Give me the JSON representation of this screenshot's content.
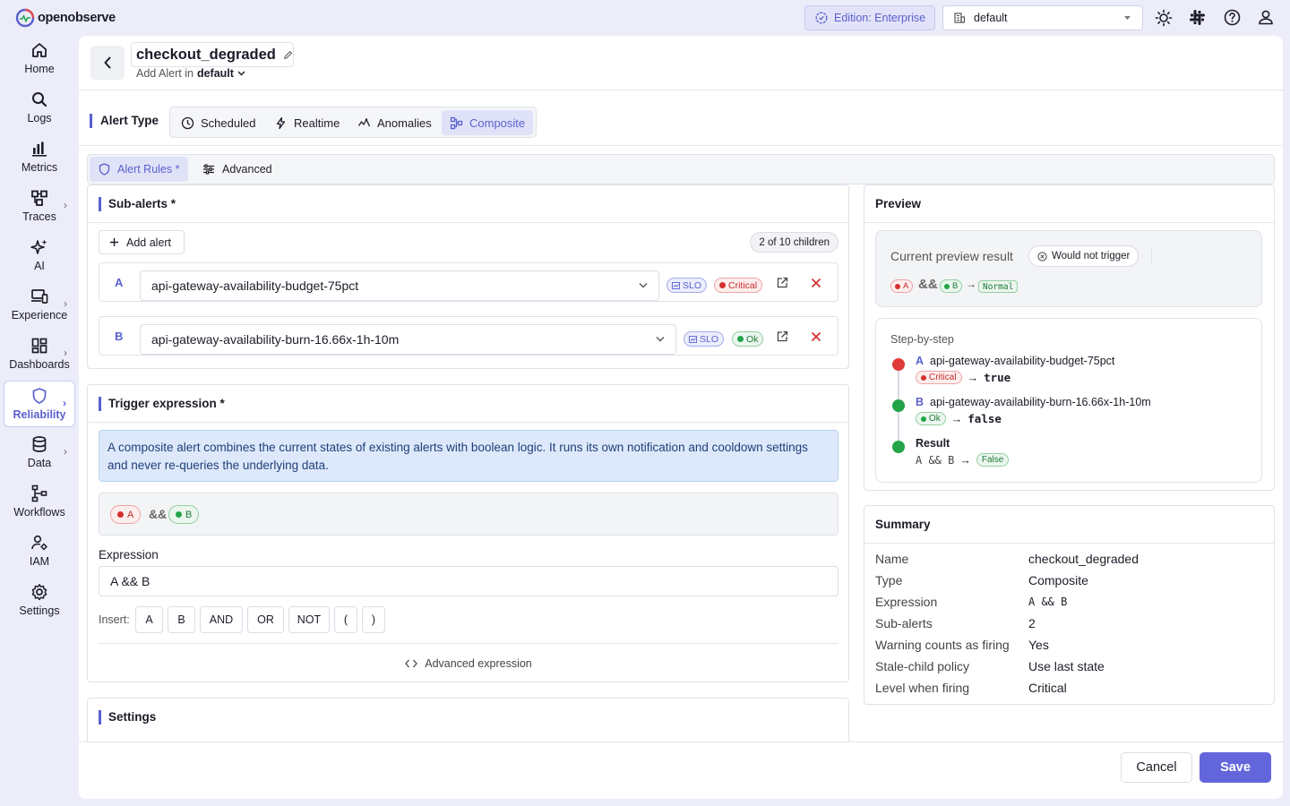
{
  "app": {
    "brand": "openobserve",
    "accent": "#5a60cf"
  },
  "topbar": {
    "edition": "Edition: Enterprise",
    "org": "default",
    "icons": [
      "theme-sun-icon",
      "slack-icon",
      "help-icon",
      "user-icon"
    ]
  },
  "sidebar": {
    "items": [
      {
        "label": "Home",
        "icon": "home-icon",
        "expand": false
      },
      {
        "label": "Logs",
        "icon": "search-icon",
        "expand": false
      },
      {
        "label": "Metrics",
        "icon": "bar-chart-icon",
        "expand": false
      },
      {
        "label": "Traces",
        "icon": "traces-icon",
        "expand": true
      },
      {
        "label": "AI",
        "icon": "sparkle-icon",
        "expand": false
      },
      {
        "label": "Experience",
        "icon": "devices-icon",
        "expand": true
      },
      {
        "label": "Dashboards",
        "icon": "dashboard-icon",
        "expand": true
      },
      {
        "label": "Reliability",
        "icon": "shield-icon",
        "expand": true,
        "active": true
      },
      {
        "label": "Data",
        "icon": "database-icon",
        "expand": true
      },
      {
        "label": "Workflows",
        "icon": "workflow-icon",
        "expand": false
      },
      {
        "label": "IAM",
        "icon": "user-gear-icon",
        "expand": false
      },
      {
        "label": "Settings",
        "icon": "gear-icon",
        "expand": false
      }
    ]
  },
  "header": {
    "title": "checkout_degraded",
    "subtitle_prefix": "Add Alert in",
    "folder": "default"
  },
  "alert_type": {
    "label": "Alert Type",
    "tabs": [
      "Scheduled",
      "Realtime",
      "Anomalies",
      "Composite"
    ],
    "selected": "Composite"
  },
  "rule_tabs": {
    "items": [
      "Alert Rules *",
      "Advanced"
    ],
    "selected": "Alert Rules *"
  },
  "subalerts": {
    "title": "Sub-alerts *",
    "add_label": "Add alert",
    "count": "2 of 10 children",
    "rows": [
      {
        "letter": "A",
        "name": "api-gateway-availability-budget-75pct",
        "kind": "SLO",
        "state": "Critical"
      },
      {
        "letter": "B",
        "name": "api-gateway-availability-burn-16.66x-1h-10m",
        "kind": "SLO",
        "state": "Ok"
      }
    ]
  },
  "trigger": {
    "title": "Trigger expression *",
    "info": "A composite alert combines the current states of existing alerts with boolean logic. It runs its own notification and cooldown settings and never re-queries the underlying data.",
    "visual": {
      "a": "A",
      "op": "&&",
      "b": "B"
    },
    "expression_label": "Expression",
    "expression_value": "A && B",
    "insert_label": "Insert:",
    "insert_tokens": [
      "A",
      "B",
      "AND",
      "OR",
      "NOT",
      "(",
      ")"
    ],
    "advanced_label": "Advanced expression"
  },
  "settings": {
    "title": "Settings"
  },
  "preview": {
    "title": "Preview",
    "current_label": "Current preview result",
    "result_chip": "Would not trigger",
    "visual": {
      "a": "A",
      "op": "&&",
      "b": "B",
      "arrow": "→",
      "result": "Normal"
    },
    "steps_label": "Step-by-step",
    "steps": [
      {
        "letter": "A",
        "name": "api-gateway-availability-budget-75pct",
        "state": "Critical",
        "arrow": "→",
        "value": "true",
        "color": "#e03b3b"
      },
      {
        "letter": "B",
        "name": "api-gateway-availability-burn-16.66x-1h-10m",
        "state": "Ok",
        "arrow": "→",
        "value": "false",
        "color": "#23a449"
      }
    ],
    "result": {
      "label": "Result",
      "expr": "A && B",
      "arrow": "→",
      "value": "False",
      "color": "#23a449"
    }
  },
  "summary": {
    "title": "Summary",
    "rows": [
      {
        "key": "Name",
        "value": "checkout_degraded",
        "mono": false
      },
      {
        "key": "Type",
        "value": "Composite",
        "mono": false
      },
      {
        "key": "Expression",
        "value": "A && B",
        "mono": true
      },
      {
        "key": "Sub-alerts",
        "value": "2",
        "mono": false
      },
      {
        "key": "Warning counts as firing",
        "value": "Yes",
        "mono": false
      },
      {
        "key": "Stale-child policy",
        "value": "Use last state",
        "mono": false
      },
      {
        "key": "Level when firing",
        "value": "Critical",
        "mono": false
      }
    ]
  },
  "footer": {
    "cancel": "Cancel",
    "save": "Save"
  }
}
